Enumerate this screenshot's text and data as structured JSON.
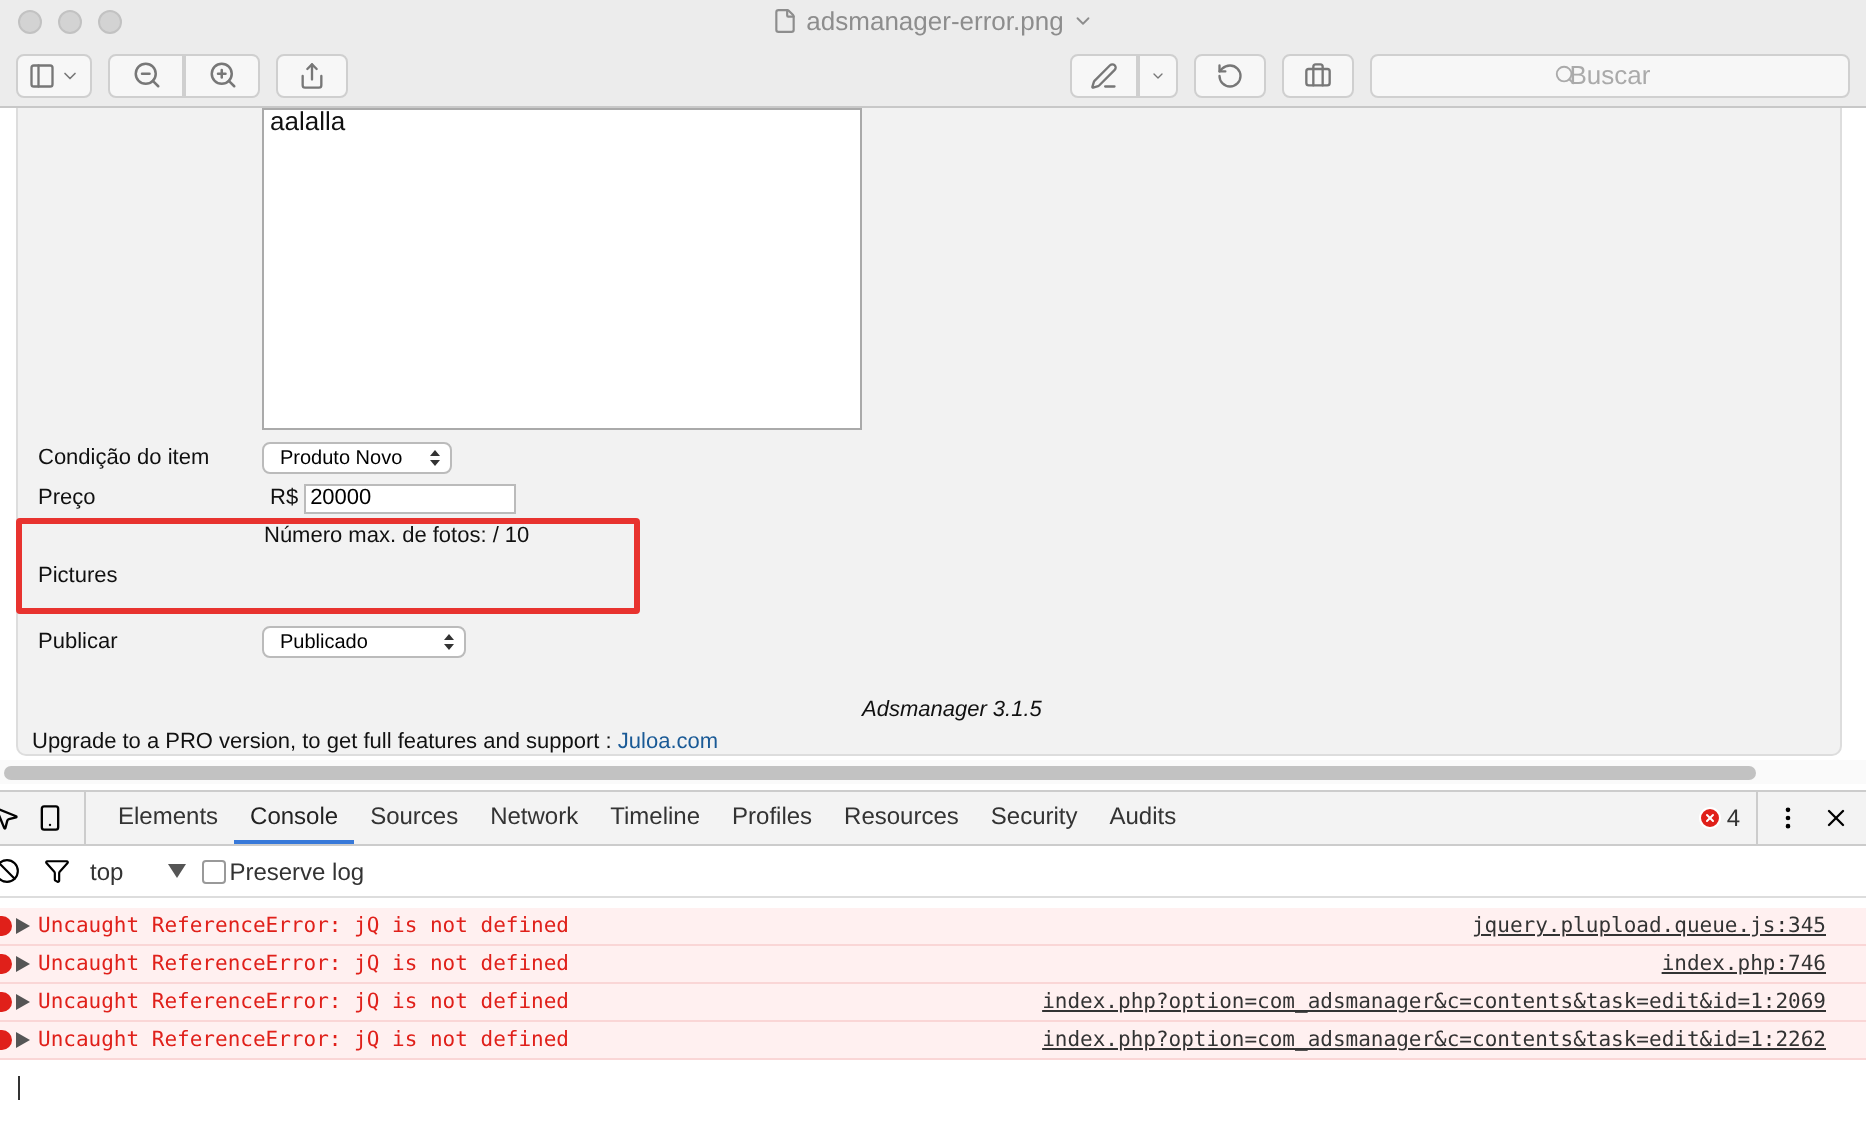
{
  "window": {
    "title": "adsmanager-error.png",
    "toolbar": {
      "search_placeholder": "Buscar"
    }
  },
  "page": {
    "description_text": "aalalla",
    "fields": [
      {
        "kind": "select",
        "label": "Condição do item",
        "value": "Produto Novo"
      },
      {
        "kind": "price",
        "label": "Preço",
        "prefix": "R$",
        "value": "20000"
      }
    ],
    "highlighted": {
      "note": "Número max. de fotos: / 10",
      "label": "Pictures"
    },
    "publish": {
      "label": "Publicar",
      "value": "Publicado"
    },
    "version": "Adsmanager 3.1.5",
    "footer": {
      "text": "Upgrade to a PRO version, to get full features and support :",
      "link": "Juloa.com"
    }
  },
  "devtools": {
    "tabs": [
      {
        "label": "Elements",
        "selected": false
      },
      {
        "label": "Console",
        "selected": true
      },
      {
        "label": "Sources",
        "selected": false
      },
      {
        "label": "Network",
        "selected": false
      },
      {
        "label": "Timeline",
        "selected": false
      },
      {
        "label": "Profiles",
        "selected": false
      },
      {
        "label": "Resources",
        "selected": false
      },
      {
        "label": "Security",
        "selected": false
      },
      {
        "label": "Audits",
        "selected": false
      }
    ],
    "error_count": "4",
    "context": "top",
    "preserve_log": {
      "label": "Preserve log",
      "checked": false
    },
    "messages": [
      {
        "text": "Uncaught ReferenceError: jQ is not defined",
        "source": "jquery.plupload.queue.js:345"
      },
      {
        "text": "Uncaught ReferenceError: jQ is not defined",
        "source": "index.php:746"
      },
      {
        "text": "Uncaught ReferenceError: jQ is not defined",
        "source": "index.php?option=com_adsmanager&c=contents&task=edit&id=1:2069"
      },
      {
        "text": "Uncaught ReferenceError: jQ is not defined",
        "source": "index.php?option=com_adsmanager&c=contents&task=edit&id=1:2262"
      }
    ]
  }
}
